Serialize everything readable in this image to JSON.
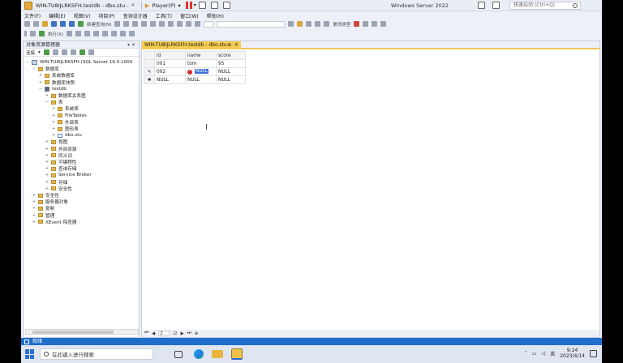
{
  "vmbar": {
    "doc_title": "WIN-TU8IJLRKSFH.testdb - dbo.stu - ",
    "player_label": "Player(P)",
    "os_title": "Windows Server 2022",
    "search_placeholder": "快速启动 (Ctrl+Q)"
  },
  "menu": [
    "文件(F)",
    "编辑(E)",
    "视图(V)",
    "项目(P)",
    "查询设计器",
    "工具(T)",
    "窗口(W)",
    "帮助(H)"
  ],
  "toolbar": {
    "new_query": "新建查询(N)",
    "execute": "执行(X)",
    "change_type": "更改类型"
  },
  "object_explorer": {
    "title": "对象资源管理器",
    "connect": "连接",
    "tree": [
      {
        "label": "WIN-TU8IJLRKSFH (SQL Server 16.0.1000",
        "level": 0,
        "icon": "server",
        "exp": "−"
      },
      {
        "label": "数据库",
        "level": 1,
        "icon": "folder",
        "exp": "−"
      },
      {
        "label": "系统数据库",
        "level": 2,
        "icon": "folder",
        "exp": "+"
      },
      {
        "label": "数据库快照",
        "level": 2,
        "icon": "folder",
        "exp": "+"
      },
      {
        "label": "testdb",
        "level": 2,
        "icon": "db",
        "exp": "−"
      },
      {
        "label": "数据库关系图",
        "level": 3,
        "icon": "folder",
        "exp": "+"
      },
      {
        "label": "表",
        "level": 3,
        "icon": "folder",
        "exp": "−"
      },
      {
        "label": "系统表",
        "level": 4,
        "icon": "folder",
        "exp": "+"
      },
      {
        "label": "FileTables",
        "level": 4,
        "icon": "folder",
        "exp": "+"
      },
      {
        "label": "外部表",
        "level": 4,
        "icon": "folder",
        "exp": "+"
      },
      {
        "label": "图形表",
        "level": 4,
        "icon": "folder",
        "exp": "+"
      },
      {
        "label": "dbo.stu",
        "level": 4,
        "icon": "table",
        "exp": "+"
      },
      {
        "label": "视图",
        "level": 3,
        "icon": "folder",
        "exp": "+"
      },
      {
        "label": "外部资源",
        "level": 3,
        "icon": "folder",
        "exp": "+"
      },
      {
        "label": "同义词",
        "level": 3,
        "icon": "folder",
        "exp": "+"
      },
      {
        "label": "可编程性",
        "level": 3,
        "icon": "folder",
        "exp": "+"
      },
      {
        "label": "查询存储",
        "level": 3,
        "icon": "folder",
        "exp": "+"
      },
      {
        "label": "Service Broker",
        "level": 3,
        "icon": "folder",
        "exp": "+"
      },
      {
        "label": "存储",
        "level": 3,
        "icon": "folder",
        "exp": "+"
      },
      {
        "label": "安全性",
        "level": 3,
        "icon": "folder",
        "exp": "+"
      },
      {
        "label": "安全性",
        "level": 1,
        "icon": "folder",
        "exp": "+"
      },
      {
        "label": "服务器对象",
        "level": 1,
        "icon": "folder",
        "exp": "+"
      },
      {
        "label": "复制",
        "level": 1,
        "icon": "folder",
        "exp": "+"
      },
      {
        "label": "管理",
        "level": 1,
        "icon": "folder",
        "exp": "+"
      },
      {
        "label": "XEvent 探查器",
        "level": 1,
        "icon": "folder",
        "exp": "+"
      }
    ]
  },
  "document": {
    "tab_label": "WIN-TU8IJLRKSFH.testdb - dbo.stu",
    "columns": [
      "id",
      "name",
      "score"
    ],
    "rows": [
      {
        "marker": "",
        "cells": [
          "001",
          "tom",
          "95"
        ],
        "error": false
      },
      {
        "marker": "✎",
        "cells": [
          "002",
          "NULL",
          "NULL"
        ],
        "error": true
      },
      {
        "marker": "✱",
        "cells": [
          "NULL",
          "NULL",
          "NULL"
        ],
        "error": false
      }
    ],
    "pager": {
      "current": "2",
      "total": "/2"
    }
  },
  "status": {
    "text": "就绪"
  },
  "taskbar": {
    "search_placeholder": "在此键入进行搜索",
    "time": "9:24",
    "date": "2023/4/14",
    "ime": "英"
  }
}
